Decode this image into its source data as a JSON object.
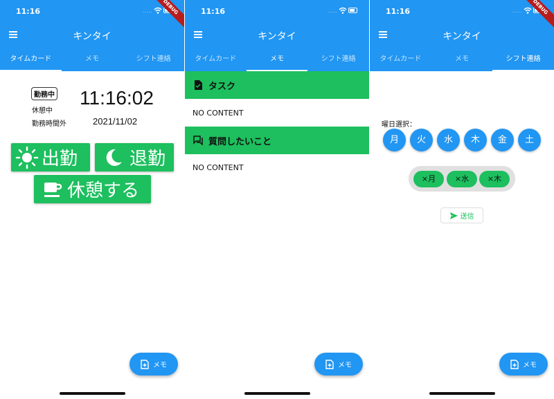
{
  "common": {
    "status_time": "11:16",
    "signal": ".....",
    "debug_banner": "DEBUG",
    "app_title": "キンタイ",
    "tabs": [
      "タイムカード",
      "メモ",
      "シフト連絡"
    ],
    "fab_label": "メモ",
    "colors": {
      "primary": "#2196f3",
      "green": "#1dbf5e"
    }
  },
  "timecard": {
    "status_badge": "勤務中",
    "break_label": "休憩中",
    "off_hours_label": "勤務時間外",
    "clock": "11:16:02",
    "date": "2021/11/02",
    "clock_in_label": "出勤",
    "clock_out_label": "退勤",
    "break_button_label": "休憩する",
    "icons": [
      "sun-icon",
      "moon-icon",
      "coffee-icon"
    ]
  },
  "memo": {
    "sections": [
      {
        "title": "タスク",
        "content": "NO CONTENT",
        "icon": "note-icon"
      },
      {
        "title": "質問したいこと",
        "content": "NO CONTENT",
        "icon": "chat-icon"
      }
    ]
  },
  "shift": {
    "day_select_label": "曜日選択：",
    "days": [
      "月",
      "火",
      "水",
      "木",
      "金",
      "土"
    ],
    "chips": [
      "×月",
      "×水",
      "×木"
    ],
    "send_label": "送信"
  }
}
